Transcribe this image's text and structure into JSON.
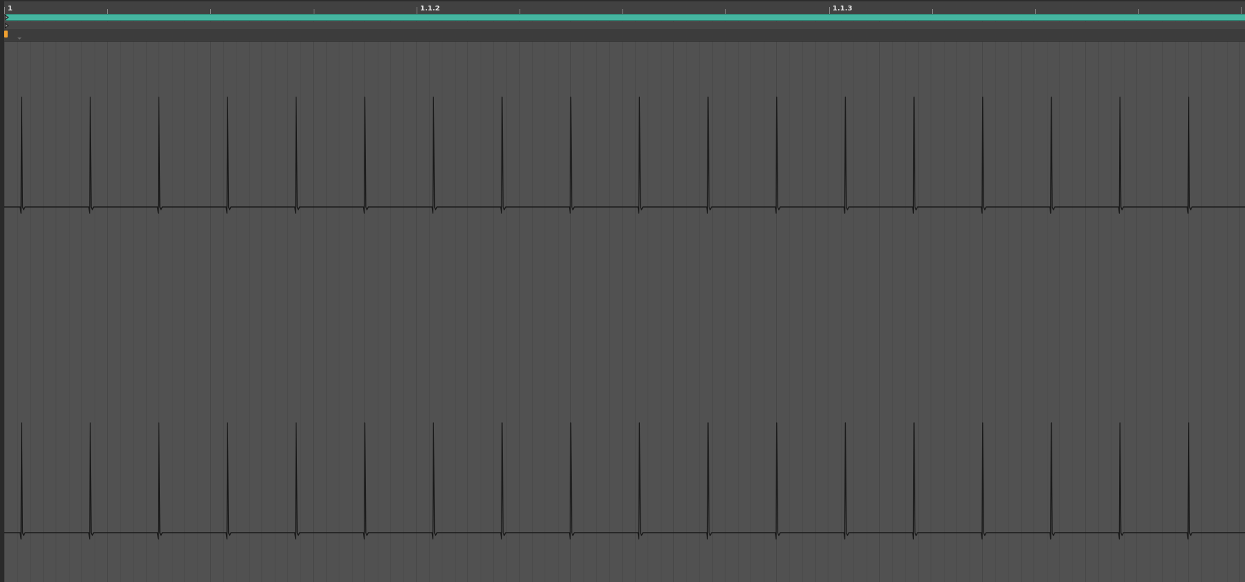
{
  "ruler": {
    "labels": [
      "1",
      "1.1.2",
      "1.1.3"
    ]
  },
  "colors": {
    "background": "#515151",
    "loop_bar": "#45b5a0",
    "marker": "#f0a030",
    "waveform": "#1a1a1a"
  },
  "icons": [
    "launch-arrow-icon",
    "fold-chevron-icon",
    "start-marker-icon"
  ]
}
